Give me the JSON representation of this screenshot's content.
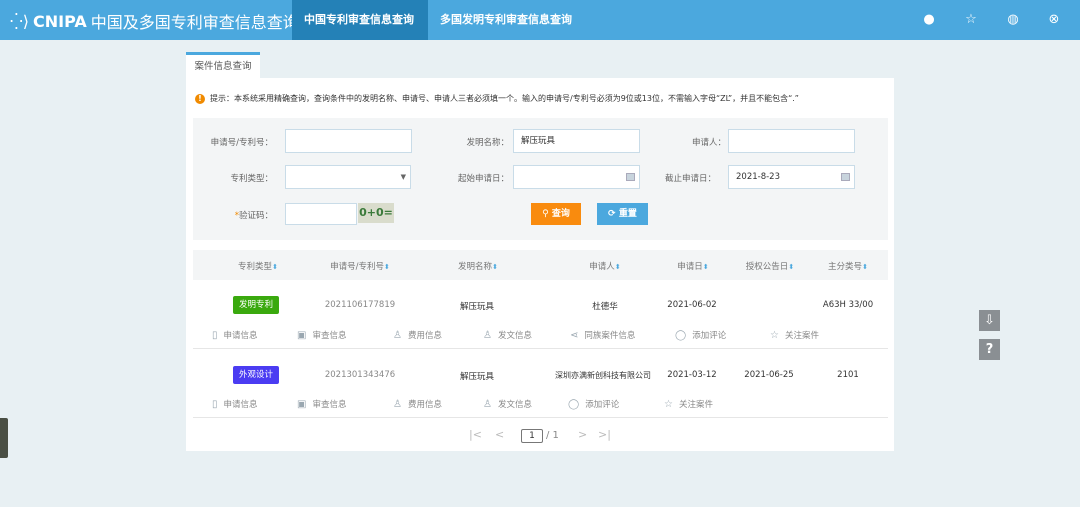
{
  "header": {
    "logo_text": "CNIPA",
    "site_title": "中国及多国专利审查信息查询",
    "tabs": [
      {
        "label": "中国专利审查信息查询"
      },
      {
        "label": "多国发明专利审查信息查询"
      }
    ]
  },
  "panel_tab": "案件信息查询",
  "tip": "提示：本系统采用精确查询，查询条件中的发明名称、申请号、申请人三者必须填一个。输入的申请号/专利号必须为9位或13位，不需输入字母“ZL”，并且不能包含“.”",
  "form": {
    "app_no_label": "申请号/专利号：",
    "app_no_value": "",
    "title_label": "发明名称：",
    "title_value": "解压玩具",
    "applicant_label": "申请人：",
    "applicant_value": "",
    "type_label": "专利类型：",
    "type_value": "",
    "start_label": "起始申请日：",
    "start_value": "",
    "end_label": "截止申请日：",
    "end_value": "2021-8-23",
    "captcha_required": "*",
    "captcha_label": "验证码：",
    "captcha_value": "",
    "captcha_image": "0+0=",
    "search_label": "查询",
    "reset_label": "重置"
  },
  "columns": [
    "专利类型",
    "申请号/专利号",
    "发明名称",
    "申请人",
    "申请日",
    "授权公告日",
    "主分类号"
  ],
  "rows": [
    {
      "type": "发明专利",
      "type_color": "#3aa90e",
      "app_no": "2021106177819",
      "title": "解压玩具",
      "applicant": "杜德华",
      "app_date": "2021-06-02",
      "grant_date": "",
      "ipc": "A63H 33/00",
      "actions": [
        "申请信息",
        "审查信息",
        "费用信息",
        "发文信息",
        "同族案件信息",
        "添加评论",
        "关注案件"
      ]
    },
    {
      "type": "外观设计",
      "type_color": "#4b3cf2",
      "app_no": "2021301343476",
      "title": "解压玩具",
      "applicant": "深圳亦满新创科技有限公司",
      "app_date": "2021-03-12",
      "grant_date": "2021-06-25",
      "ipc": "2101",
      "actions": [
        "申请信息",
        "审查信息",
        "费用信息",
        "发文信息",
        "添加评论",
        "关注案件"
      ]
    }
  ],
  "pagination": {
    "first": "|<",
    "prev": "<",
    "page": "1",
    "total": "/ 1",
    "next": ">",
    "last": ">|"
  },
  "side": {
    "download": "⇩",
    "help": "?"
  }
}
